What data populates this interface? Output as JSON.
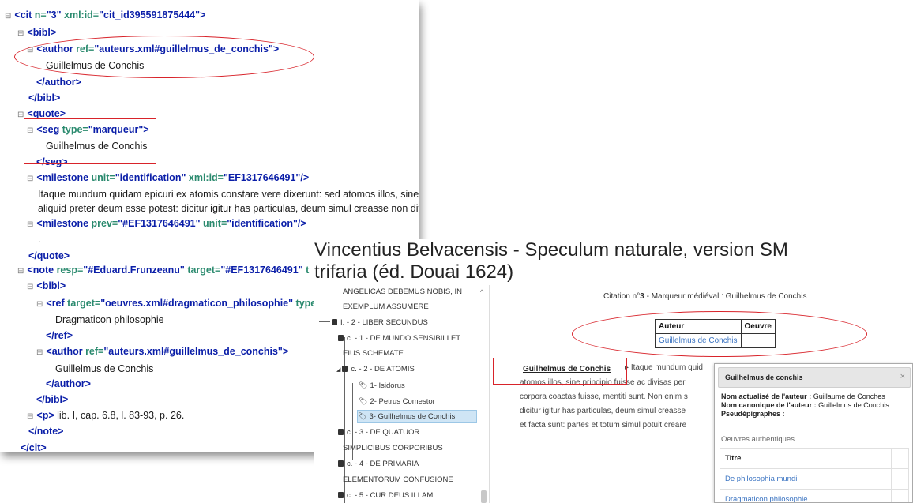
{
  "xml": {
    "toggle": "⊟",
    "cit": {
      "tag": "<cit",
      "n_attr": "n=",
      "n_val": "\"3\"",
      "id_attr": "xml:id=",
      "id_val": "\"cit_id395591875444\"",
      "close": ">"
    },
    "bibl_open": "<bibl>",
    "author1": {
      "tag": "<author",
      "ref_attr": "ref=",
      "ref_val": "\"auteurs.xml#guillelmus_de_conchis\"",
      "close": ">"
    },
    "author1_text": "Guillelmus de Conchis",
    "author1_end": "</author>",
    "bibl1_end": "</bibl>",
    "quote_open": "<quote>",
    "seg": {
      "tag": "<seg",
      "type_attr": "type=",
      "type_val": "\"marqueur\"",
      "close": ">"
    },
    "seg_text": "Guilhelmus de Conchis",
    "seg_end": "</seg>",
    "milestone1": {
      "tag": "<milestone",
      "unit_attr": "unit=",
      "unit_val": "\"identification\"",
      "id_attr": "xml:id=",
      "id_val": "\"EF1317646491\"",
      "close": "/>"
    },
    "quote_line1": "Itaque mundum quidam epicuri ex atomis constare vere dixerunt: sed atomos illos, sine pr",
    "quote_line2": "aliquid preter deum esse potest: dicitur igitur has particulas, deum simul creasse non divis",
    "milestone2": {
      "tag": "<milestone",
      "prev_attr": "prev=",
      "prev_val": "\"#EF1317646491\"",
      "unit_attr": "unit=",
      "unit_val": "\"identification\"",
      "close": "/>"
    },
    "dot": ".",
    "quote_end": "</quote>",
    "note": {
      "tag": "<note",
      "resp_attr": "resp=",
      "resp_val": "\"#Eduard.Frunzeanu\"",
      "target_attr": "target=",
      "target_val": "\"#EF1317646491\"",
      "trail": "t"
    },
    "bibl2_open": "<bibl>",
    "ref": {
      "tag": "<ref",
      "target_attr": "target=",
      "target_val": "\"oeuvres.xml#dragmaticon_philosophie\"",
      "type_attr": "type"
    },
    "ref_text": "Dragmaticon philosophie",
    "ref_end": "</ref>",
    "author2": {
      "tag": "<author",
      "ref_attr": "ref=",
      "ref_val": "\"auteurs.xml#guillelmus_de_conchis\"",
      "close": ">"
    },
    "author2_text": "Guillelmus de Conchis",
    "author2_end": "</author>",
    "bibl2_end": "</bibl>",
    "p": {
      "tag": "<p>",
      "text": "lib. I, cap. 6.8, l. 83-93, p. 26."
    },
    "note_end": "</note>",
    "last_tag": "</cit>"
  },
  "web": {
    "title_line1": "Vincentius Belvacensis - Speculum naturale, version SM",
    "title_line2": "trifaria (éd. Douai 1624)",
    "tree": [
      {
        "label": "ANGELICAS DEBEMUS NOBIS, IN"
      },
      {
        "label": "EXEMPLUM ASSUMERE"
      },
      {
        "label": "I. - 2 - LIBER SECUNDUS"
      },
      {
        "label": "c. - 1 - DE MUNDO SENSIBILI ET"
      },
      {
        "label": "EIUS SCHEMATE"
      },
      {
        "label": "c. - 2 - DE ATOMIS"
      },
      {
        "label": "1- Isidorus"
      },
      {
        "label": "2- Petrus Comestor"
      },
      {
        "label": "3- Guilhelmus de Conchis"
      },
      {
        "label": "c. - 3 - DE QUATUOR"
      },
      {
        "label": "SIMPLICIBUS CORPORIBUS"
      },
      {
        "label": "c. - 4 - DE PRIMARIA"
      },
      {
        "label": "ELEMENTORUM CONFUSIONE"
      },
      {
        "label": "c. - 5 - CUR DEUS ILLAM"
      }
    ],
    "citation_head_prefix": "Citation n°",
    "citation_number": "3",
    "citation_head_suffix": " - Marqueur médiéval : Guilhelmus de Conchis",
    "table_header_author": "Auteur",
    "table_header_work": "Oeuvre",
    "table_author": "Guillelmus de Conchis",
    "marker": "Guilhelmus de Conchis",
    "body_lines": [
      "Itaque mundum quid",
      "atomos illos, sine principio fuisse ac divisas per",
      "corpora coactas fuisse, mentiti sunt. Non enim s",
      "dicitur igitur has particulas, deum simul creasse",
      "et facta sunt: partes et totum simul potuit creare"
    ],
    "popup": {
      "title": "Guilhelmus de conchis",
      "close": "×",
      "actual_label": "Nom actualisé de l'auteur :",
      "actual_value": "Guillaume de Conches",
      "canon_label": "Nom canonique de l'auteur :",
      "canon_value": "Guillelmus de Conchis",
      "pseudo_label": "Pseudépigraphes :",
      "section": "Oeuvres authentiques",
      "col_title": "Titre",
      "works": [
        "De philosophia mundi",
        "Dragmaticon philosophie"
      ]
    }
  }
}
